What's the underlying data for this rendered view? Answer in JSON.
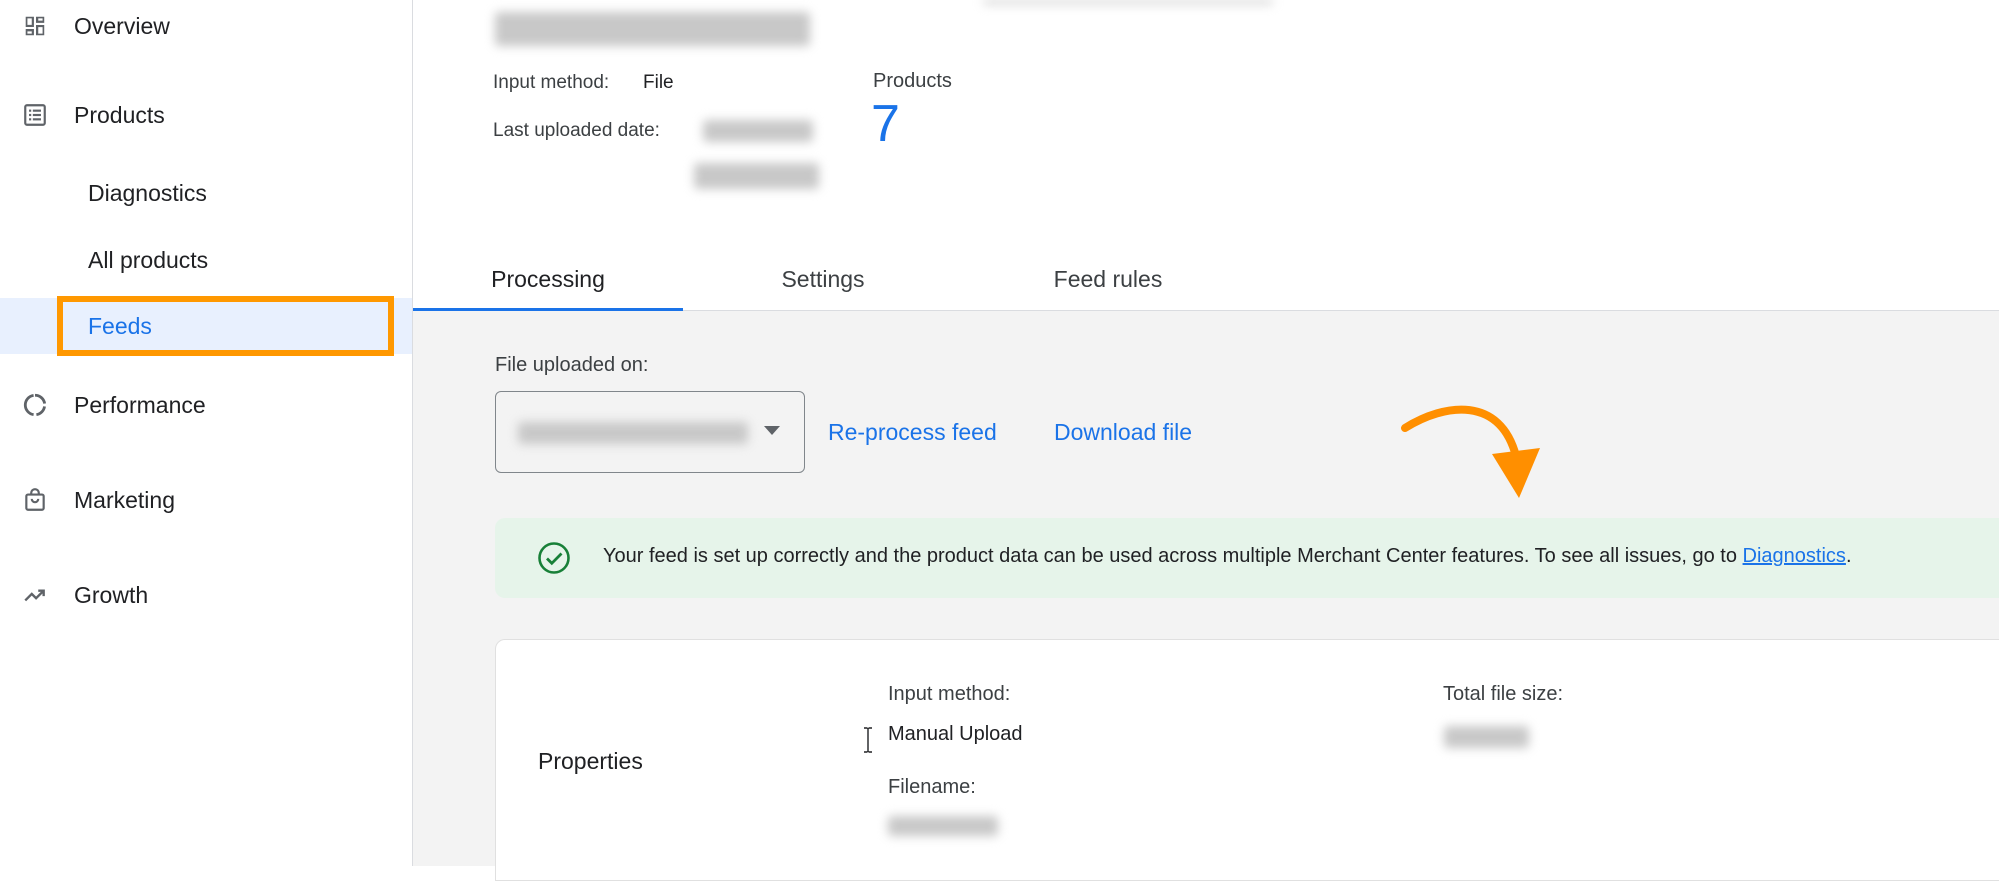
{
  "sidebar": {
    "items": [
      {
        "label": "Overview",
        "icon": "dashboard-icon"
      },
      {
        "label": "Products",
        "icon": "list-icon"
      },
      {
        "label": "Performance",
        "icon": "performance-icon"
      },
      {
        "label": "Marketing",
        "icon": "shopping-bag-icon"
      },
      {
        "label": "Growth",
        "icon": "trending-up-icon"
      }
    ],
    "subitems": [
      {
        "label": "Diagnostics"
      },
      {
        "label": "All products"
      },
      {
        "label": "Feeds",
        "active": true
      }
    ]
  },
  "header": {
    "input_method_label": "Input method:",
    "input_method_value": "File",
    "last_uploaded_label": "Last uploaded date:",
    "products_label": "Products",
    "products_count": "7"
  },
  "tabs": [
    {
      "label": "Processing",
      "active": true
    },
    {
      "label": "Settings"
    },
    {
      "label": "Feed rules"
    }
  ],
  "content": {
    "file_uploaded_label": "File uploaded on:",
    "reprocess_label": "Re-process feed",
    "download_label": "Download file",
    "banner_text": "Your feed is set up correctly and the product data can be used across multiple Merchant Center features. To see all issues, go to",
    "banner_link": "Diagnostics",
    "banner_suffix": ".",
    "properties": {
      "title": "Properties",
      "input_method_label": "Input method:",
      "input_method_value": "Manual Upload",
      "filename_label": "Filename:",
      "total_size_label": "Total file size:"
    }
  },
  "colors": {
    "accent": "#1a73e8",
    "highlight": "#ff9800",
    "success_bg": "#e6f4ea",
    "success_icon": "#188038"
  }
}
